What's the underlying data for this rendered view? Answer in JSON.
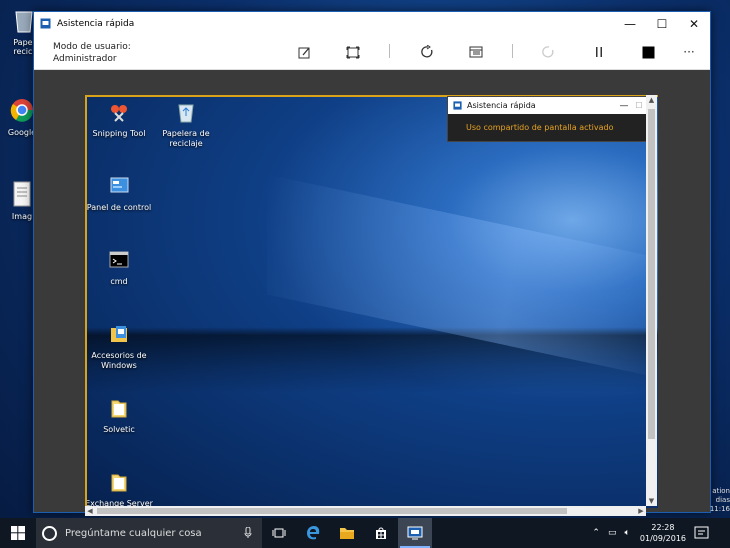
{
  "outer_desktop": {
    "icons": [
      {
        "label": "Papel\nrecicl",
        "icon": "recycle-bin-icon"
      },
      {
        "label": "Google",
        "icon": "chrome-icon"
      },
      {
        "label": "Imag",
        "icon": "document-icon"
      }
    ]
  },
  "window": {
    "title": "Asistencia rápida",
    "controls": {
      "minimize": "—",
      "maximize": "☐",
      "close": "✕"
    }
  },
  "toolbar": {
    "user_mode_label": "Modo de usuario:",
    "user_mode_value": "Administrador",
    "buttons": [
      {
        "name": "annotate-icon"
      },
      {
        "name": "actual-size-icon"
      },
      {
        "name": "restart-icon"
      },
      {
        "name": "task-manager-icon"
      },
      {
        "name": "reconnect-icon"
      },
      {
        "name": "pause-icon"
      },
      {
        "name": "stop-icon"
      },
      {
        "name": "more-icon",
        "label": "···"
      }
    ]
  },
  "remote_desktop": {
    "icons": [
      {
        "label": "Snipping Tool",
        "icon": "snipping-tool-icon"
      },
      {
        "label": "Papelera de\nreciclaje",
        "icon": "recycle-bin-icon"
      },
      {
        "label": "Panel de control",
        "icon": "control-panel-icon"
      },
      {
        "label": "cmd",
        "icon": "cmd-icon"
      },
      {
        "label": "Accesorios de\nWindows",
        "icon": "accessories-folder-icon"
      },
      {
        "label": "Solvetic",
        "icon": "folder-icon"
      },
      {
        "label": "Exchange Server",
        "icon": "folder-icon"
      }
    ],
    "popup": {
      "title": "Asistencia rápida",
      "message": "Uso compartido de pantalla activado"
    }
  },
  "taskbar": {
    "search_placeholder": "Pregúntame cualquier cosa",
    "apps": [
      "task-view-icon",
      "edge-icon",
      "file-explorer-icon",
      "store-icon",
      "quick-assist-icon"
    ],
    "time": "22:28",
    "date": "01/09/2016"
  },
  "edge_text": {
    "line1": "ation",
    "line2": "dias",
    "line3": "11:16"
  },
  "colors": {
    "accent": "#1c5fb0",
    "frame": "#d8a21a",
    "popup_text": "#e8a221"
  }
}
